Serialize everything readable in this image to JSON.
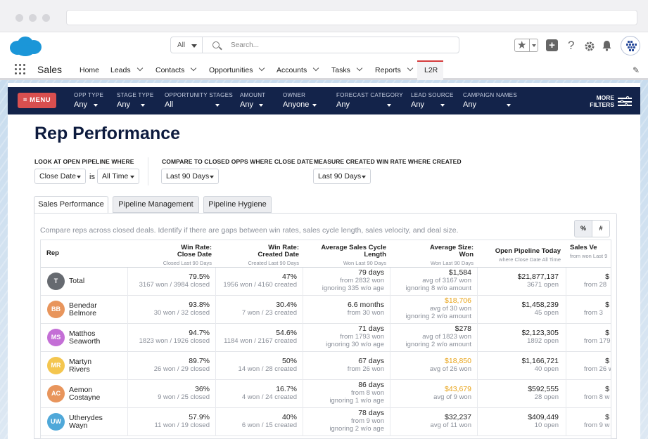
{
  "header": {
    "scope": "All",
    "search_placeholder": "Search...",
    "help_glyph": "?"
  },
  "nav": {
    "app_name": "Sales",
    "items": [
      "Home",
      "Leads",
      "Contacts",
      "Opportunities",
      "Accounts",
      "Tasks",
      "Reports"
    ],
    "active": "L2R"
  },
  "filters": {
    "menu_label": "≡ MENU",
    "items": [
      {
        "label": "OPP TYPE",
        "value": "Any"
      },
      {
        "label": "STAGE TYPE",
        "value": "Any"
      },
      {
        "label": "OPPORTUNITY STAGES",
        "value": "All"
      },
      {
        "label": "AMOUNT",
        "value": "Any"
      },
      {
        "label": "OWNER",
        "value": "Anyone"
      },
      {
        "label": "FORECAST CATEGORY",
        "value": "Any"
      },
      {
        "label": "LEAD SOURCE",
        "value": "Any"
      },
      {
        "label": "CAMPAIGN NAMES",
        "value": "Any"
      }
    ],
    "more_line1": "MORE",
    "more_line2": "FILTERS"
  },
  "page": {
    "title": "Rep Performance",
    "open_pipeline_label": "LOOK AT OPEN PIPELINE WHERE",
    "open_pipeline_field": "Close Date",
    "is_text": "is",
    "open_pipeline_range": "All Time",
    "closed_label": "COMPARE TO CLOSED OPPS WHERE CLOSE DATE",
    "closed_range": "Last 90 Days",
    "created_label": "MEASURE CREATED WIN RATE WHERE CREATED",
    "created_range": "Last 90 Days"
  },
  "tabs": [
    "Sales Performance",
    "Pipeline Management",
    "Pipeline Hygiene"
  ],
  "panel": {
    "hint": "Compare reps across closed deals. Identify if there are gaps between win rates, sales cycle length, sales velocity, and deal size.",
    "toggle_pct": "%",
    "toggle_num": "#"
  },
  "table": {
    "columns": [
      {
        "title": "Rep",
        "title2": "",
        "sub": ""
      },
      {
        "title": "Win Rate:",
        "title2": "Close Date",
        "sub": "Closed Last 90 Days"
      },
      {
        "title": "Win Rate:",
        "title2": "Created Date",
        "sub": "Created Last 90 Days"
      },
      {
        "title": "Average Sales Cycle",
        "title2": "Length",
        "sub": "Won Last 90 Days"
      },
      {
        "title": "Average Size:",
        "title2": "Won",
        "sub": "Won Last 90 Days"
      },
      {
        "title": "Open Pipeline Today",
        "title2": "",
        "sub": "where Close Date All Time"
      },
      {
        "title": "Sales Ve",
        "title2": "",
        "sub": "from won Last 9"
      }
    ],
    "rows": [
      {
        "initials": "T",
        "color": "#666a70",
        "name1": "Total",
        "name2": "",
        "c1": [
          "79.5%",
          "3167 won / 3984 closed"
        ],
        "c2": [
          "47%",
          "1956 won / 4160 created"
        ],
        "c3": [
          "79 days",
          "from 2832 won",
          "ignoring 335 w/o age"
        ],
        "c4": [
          "$1,584",
          "avg of 3167 won",
          "ignoring 8 w/o amount"
        ],
        "c4_orange": false,
        "c5": [
          "$21,877,137",
          "3671 open"
        ],
        "c6": [
          "$",
          "from 28"
        ]
      },
      {
        "initials": "BB",
        "color": "#e8955c",
        "name1": "Benedar",
        "name2": "Belmore",
        "c1": [
          "93.8%",
          "30 won / 32 closed"
        ],
        "c2": [
          "30.4%",
          "7 won / 23 created"
        ],
        "c3": [
          "6.6 months",
          "from 30 won"
        ],
        "c4": [
          "$18,706",
          "avg of 30 won",
          "ignoring 2 w/o amount"
        ],
        "c4_orange": true,
        "c5": [
          "$1,458,239",
          "45 open"
        ],
        "c6": [
          "$",
          "from 3"
        ]
      },
      {
        "initials": "MS",
        "color": "#c46fd6",
        "name1": "Matthos",
        "name2": "Seaworth",
        "c1": [
          "94.7%",
          "1823 won / 1926 closed"
        ],
        "c2": [
          "54.6%",
          "1184 won / 2167 created"
        ],
        "c3": [
          "71 days",
          "from 1793 won",
          "ignoring 30 w/o age"
        ],
        "c4": [
          "$278",
          "avg of 1823 won",
          "ignoring 2 w/o amount"
        ],
        "c4_orange": false,
        "c5": [
          "$2,123,305",
          "1892 open"
        ],
        "c6": [
          "$",
          "from 179"
        ]
      },
      {
        "initials": "MR",
        "color": "#f4c64f",
        "name1": "Martyn",
        "name2": "Rivers",
        "c1": [
          "89.7%",
          "26 won / 29 closed"
        ],
        "c2": [
          "50%",
          "14 won / 28 created"
        ],
        "c3": [
          "67 days",
          "from 26 won"
        ],
        "c4": [
          "$18,850",
          "avg of 26 won"
        ],
        "c4_orange": true,
        "c5": [
          "$1,166,721",
          "40 open"
        ],
        "c6": [
          "$",
          "from 26 w"
        ]
      },
      {
        "initials": "AC",
        "color": "#e8955c",
        "name1": "Aemon",
        "name2": "Costayne",
        "c1": [
          "36%",
          "9 won / 25 closed"
        ],
        "c2": [
          "16.7%",
          "4 won / 24 created"
        ],
        "c3": [
          "86 days",
          "from 8 won",
          "ignoring 1 w/o age"
        ],
        "c4": [
          "$43,679",
          "avg of 9 won"
        ],
        "c4_orange": true,
        "c5": [
          "$592,555",
          "28 open"
        ],
        "c6": [
          "$",
          "from 8 w"
        ]
      },
      {
        "initials": "UW",
        "color": "#4fa8d9",
        "name1": "Utherydes",
        "name2": "Wayn",
        "c1": [
          "57.9%",
          "11 won / 19 closed"
        ],
        "c2": [
          "40%",
          "6 won / 15 created"
        ],
        "c3": [
          "78 days",
          "from 9 won",
          "ignoring 2 w/o age"
        ],
        "c4": [
          "$32,237",
          "avg of 11 won"
        ],
        "c4_orange": false,
        "c5": [
          "$409,449",
          "10 open"
        ],
        "c6": [
          "$",
          "from 9 w"
        ]
      }
    ]
  }
}
